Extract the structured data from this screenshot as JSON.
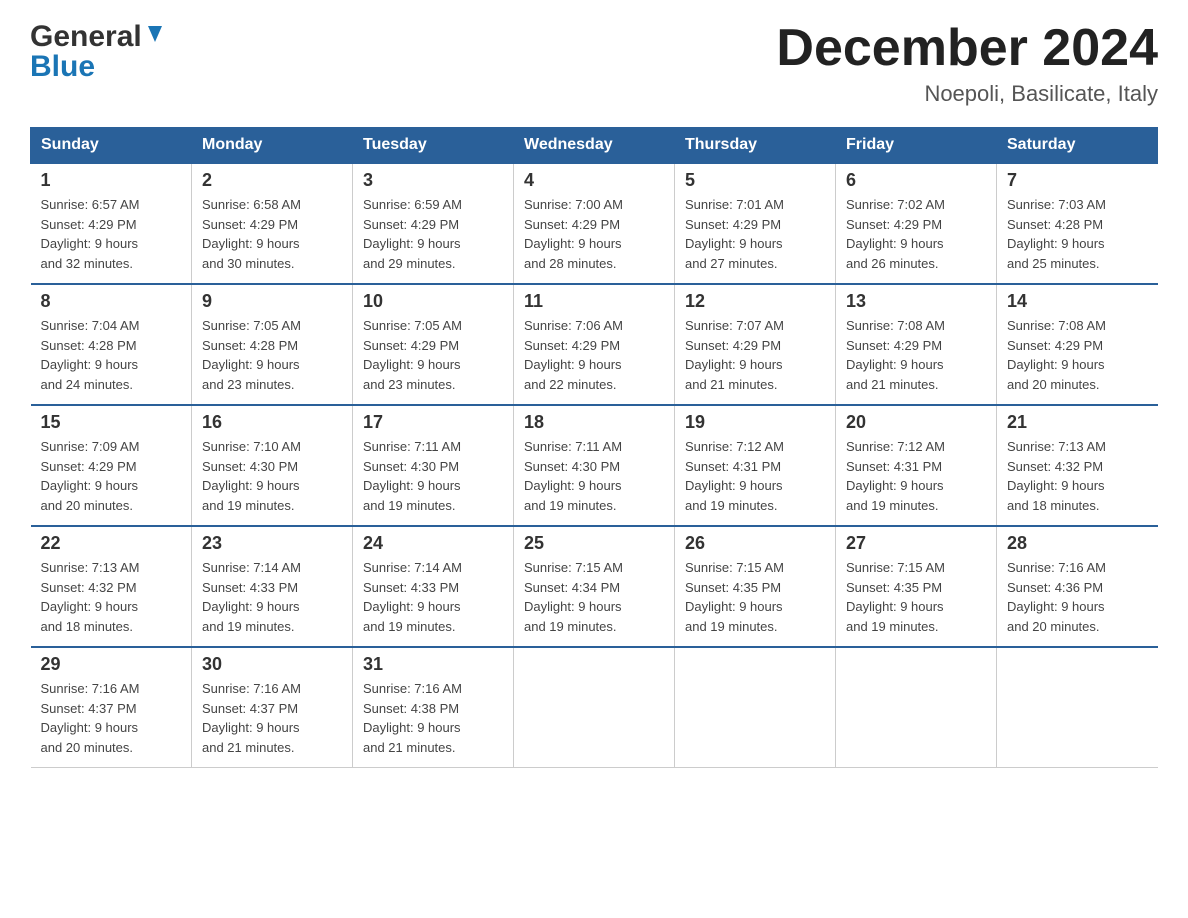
{
  "header": {
    "logo_line1": "General",
    "logo_line2": "Blue",
    "month_title": "December 2024",
    "location": "Noepoli, Basilicate, Italy"
  },
  "days_of_week": [
    "Sunday",
    "Monday",
    "Tuesday",
    "Wednesday",
    "Thursday",
    "Friday",
    "Saturday"
  ],
  "weeks": [
    [
      {
        "day": "1",
        "sunrise": "6:57 AM",
        "sunset": "4:29 PM",
        "daylight": "9 hours and 32 minutes."
      },
      {
        "day": "2",
        "sunrise": "6:58 AM",
        "sunset": "4:29 PM",
        "daylight": "9 hours and 30 minutes."
      },
      {
        "day": "3",
        "sunrise": "6:59 AM",
        "sunset": "4:29 PM",
        "daylight": "9 hours and 29 minutes."
      },
      {
        "day": "4",
        "sunrise": "7:00 AM",
        "sunset": "4:29 PM",
        "daylight": "9 hours and 28 minutes."
      },
      {
        "day": "5",
        "sunrise": "7:01 AM",
        "sunset": "4:29 PM",
        "daylight": "9 hours and 27 minutes."
      },
      {
        "day": "6",
        "sunrise": "7:02 AM",
        "sunset": "4:29 PM",
        "daylight": "9 hours and 26 minutes."
      },
      {
        "day": "7",
        "sunrise": "7:03 AM",
        "sunset": "4:28 PM",
        "daylight": "9 hours and 25 minutes."
      }
    ],
    [
      {
        "day": "8",
        "sunrise": "7:04 AM",
        "sunset": "4:28 PM",
        "daylight": "9 hours and 24 minutes."
      },
      {
        "day": "9",
        "sunrise": "7:05 AM",
        "sunset": "4:28 PM",
        "daylight": "9 hours and 23 minutes."
      },
      {
        "day": "10",
        "sunrise": "7:05 AM",
        "sunset": "4:29 PM",
        "daylight": "9 hours and 23 minutes."
      },
      {
        "day": "11",
        "sunrise": "7:06 AM",
        "sunset": "4:29 PM",
        "daylight": "9 hours and 22 minutes."
      },
      {
        "day": "12",
        "sunrise": "7:07 AM",
        "sunset": "4:29 PM",
        "daylight": "9 hours and 21 minutes."
      },
      {
        "day": "13",
        "sunrise": "7:08 AM",
        "sunset": "4:29 PM",
        "daylight": "9 hours and 21 minutes."
      },
      {
        "day": "14",
        "sunrise": "7:08 AM",
        "sunset": "4:29 PM",
        "daylight": "9 hours and 20 minutes."
      }
    ],
    [
      {
        "day": "15",
        "sunrise": "7:09 AM",
        "sunset": "4:29 PM",
        "daylight": "9 hours and 20 minutes."
      },
      {
        "day": "16",
        "sunrise": "7:10 AM",
        "sunset": "4:30 PM",
        "daylight": "9 hours and 19 minutes."
      },
      {
        "day": "17",
        "sunrise": "7:11 AM",
        "sunset": "4:30 PM",
        "daylight": "9 hours and 19 minutes."
      },
      {
        "day": "18",
        "sunrise": "7:11 AM",
        "sunset": "4:30 PM",
        "daylight": "9 hours and 19 minutes."
      },
      {
        "day": "19",
        "sunrise": "7:12 AM",
        "sunset": "4:31 PM",
        "daylight": "9 hours and 19 minutes."
      },
      {
        "day": "20",
        "sunrise": "7:12 AM",
        "sunset": "4:31 PM",
        "daylight": "9 hours and 19 minutes."
      },
      {
        "day": "21",
        "sunrise": "7:13 AM",
        "sunset": "4:32 PM",
        "daylight": "9 hours and 18 minutes."
      }
    ],
    [
      {
        "day": "22",
        "sunrise": "7:13 AM",
        "sunset": "4:32 PM",
        "daylight": "9 hours and 18 minutes."
      },
      {
        "day": "23",
        "sunrise": "7:14 AM",
        "sunset": "4:33 PM",
        "daylight": "9 hours and 19 minutes."
      },
      {
        "day": "24",
        "sunrise": "7:14 AM",
        "sunset": "4:33 PM",
        "daylight": "9 hours and 19 minutes."
      },
      {
        "day": "25",
        "sunrise": "7:15 AM",
        "sunset": "4:34 PM",
        "daylight": "9 hours and 19 minutes."
      },
      {
        "day": "26",
        "sunrise": "7:15 AM",
        "sunset": "4:35 PM",
        "daylight": "9 hours and 19 minutes."
      },
      {
        "day": "27",
        "sunrise": "7:15 AM",
        "sunset": "4:35 PM",
        "daylight": "9 hours and 19 minutes."
      },
      {
        "day": "28",
        "sunrise": "7:16 AM",
        "sunset": "4:36 PM",
        "daylight": "9 hours and 20 minutes."
      }
    ],
    [
      {
        "day": "29",
        "sunrise": "7:16 AM",
        "sunset": "4:37 PM",
        "daylight": "9 hours and 20 minutes."
      },
      {
        "day": "30",
        "sunrise": "7:16 AM",
        "sunset": "4:37 PM",
        "daylight": "9 hours and 21 minutes."
      },
      {
        "day": "31",
        "sunrise": "7:16 AM",
        "sunset": "4:38 PM",
        "daylight": "9 hours and 21 minutes."
      },
      null,
      null,
      null,
      null
    ]
  ],
  "labels": {
    "sunrise": "Sunrise:",
    "sunset": "Sunset:",
    "daylight": "Daylight:"
  }
}
